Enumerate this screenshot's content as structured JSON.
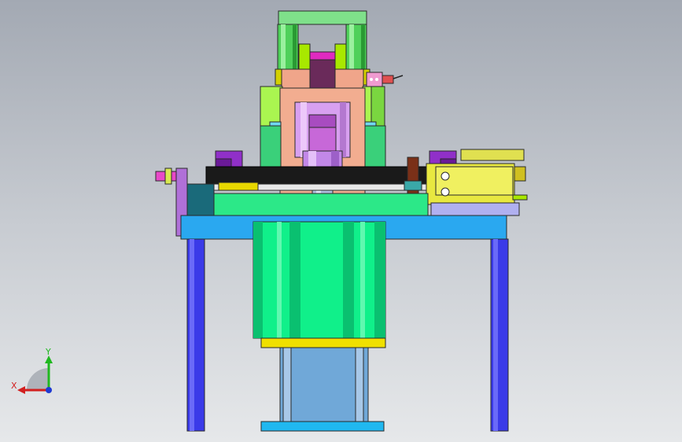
{
  "viewport": {
    "background_top": "#a3a9b3",
    "background_bottom": "#e6e8ea"
  },
  "triad": {
    "x_label": "X",
    "y_label": "Y",
    "x_color": "#d21f1f",
    "y_color": "#1fb81f",
    "z_color": "#1f3ad2"
  },
  "model": {
    "description_icon": "cad-assembly-model"
  }
}
